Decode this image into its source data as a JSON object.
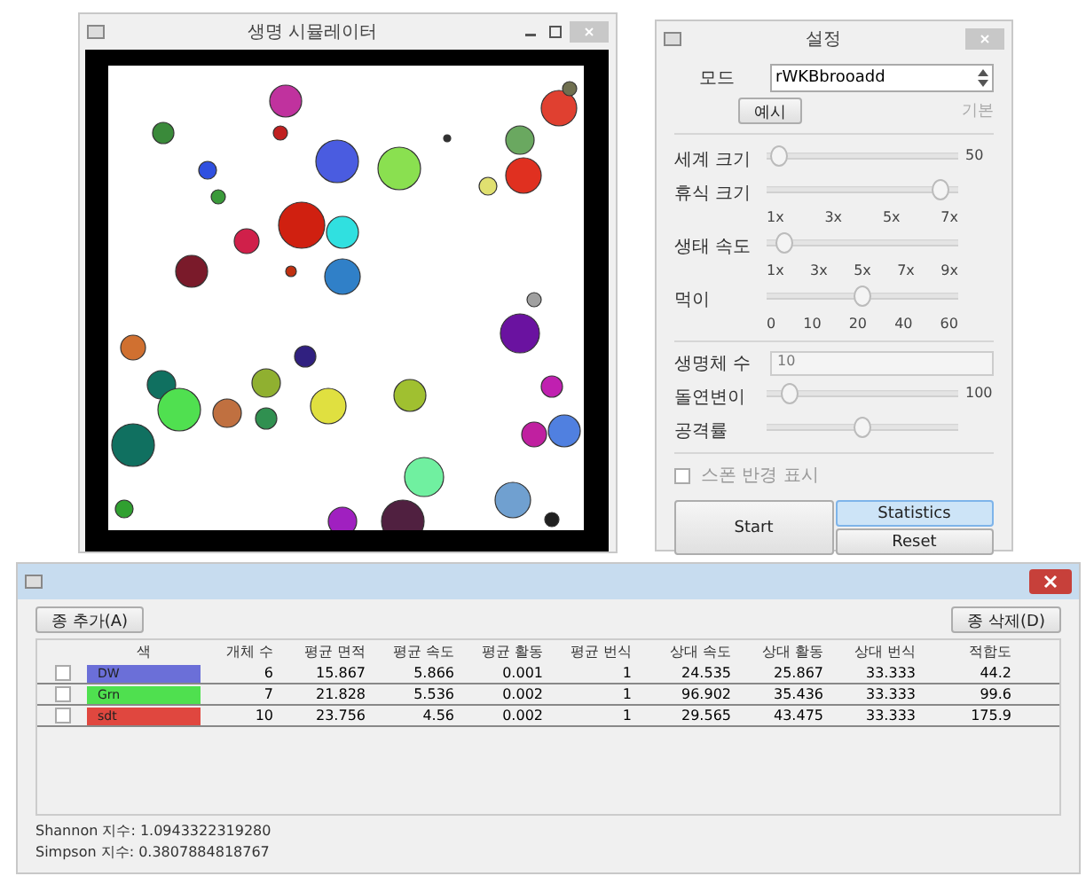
{
  "sim_window": {
    "title": "생명 시뮬레이터"
  },
  "settings": {
    "title": "설정",
    "mode_label": "모드",
    "mode_value": "rWKBbrooadd",
    "preset_button": "예시",
    "preset_hint": "기본",
    "sliders": [
      {
        "label": "세계 크기",
        "level": 0.02,
        "reading": "50"
      },
      {
        "label": "휴식 크기",
        "level": 0.95,
        "ticks": [
          "1x",
          "3x",
          "5x",
          "7x"
        ]
      },
      {
        "label": "생태 속도",
        "level": 0.05,
        "ticks": [
          "1x",
          "3x",
          "5x",
          "7x",
          "9x"
        ]
      },
      {
        "label": "먹이",
        "level": 0.5,
        "ticks": [
          "0",
          "10",
          "20",
          "40",
          "60"
        ]
      }
    ],
    "count_label": "생명체 수",
    "count_value": "10",
    "mutation": {
      "label": "돌연변이",
      "level": 0.08,
      "reading": "100"
    },
    "attack": {
      "label": "공격률",
      "level": 0.5
    },
    "spawn": {
      "label": "스폰 반경 표시",
      "checked": false
    },
    "buttons": {
      "start": "Start",
      "statistics": "Statistics",
      "reset": "Reset"
    }
  },
  "stats_window": {
    "add_button": "종 추가(A)",
    "remove_button": "종 삭제(D)",
    "columns": [
      "색",
      "개체 수",
      "평균 면적",
      "평균 속도",
      "평균 활동",
      "평균 번식",
      "상대 속도",
      "상대 활동",
      "상대 번식",
      "적합도"
    ],
    "rows": [
      {
        "checked": false,
        "color": "#6b6fd8",
        "cells": [
          "DW",
          "6",
          "15.867",
          "5.866",
          "0.001",
          "1",
          "24.535",
          "25.867",
          "33.333",
          "44.2"
        ]
      },
      {
        "checked": false,
        "color": "#4fe04f",
        "cells": [
          "Grn",
          "7",
          "21.828",
          "5.536",
          "0.002",
          "1",
          "96.902",
          "35.436",
          "33.333",
          "99.6"
        ]
      },
      {
        "checked": false,
        "color": "#e0473f",
        "cells": [
          "sdt",
          "10",
          "23.756",
          "4.56",
          "0.002",
          "1",
          "29.565",
          "43.475",
          "33.333",
          "175.9"
        ]
      }
    ],
    "shannon": "Shannon 지수: 1.0943322319280",
    "simpson": "Simpson 지수: 0.3807884818767"
  }
}
